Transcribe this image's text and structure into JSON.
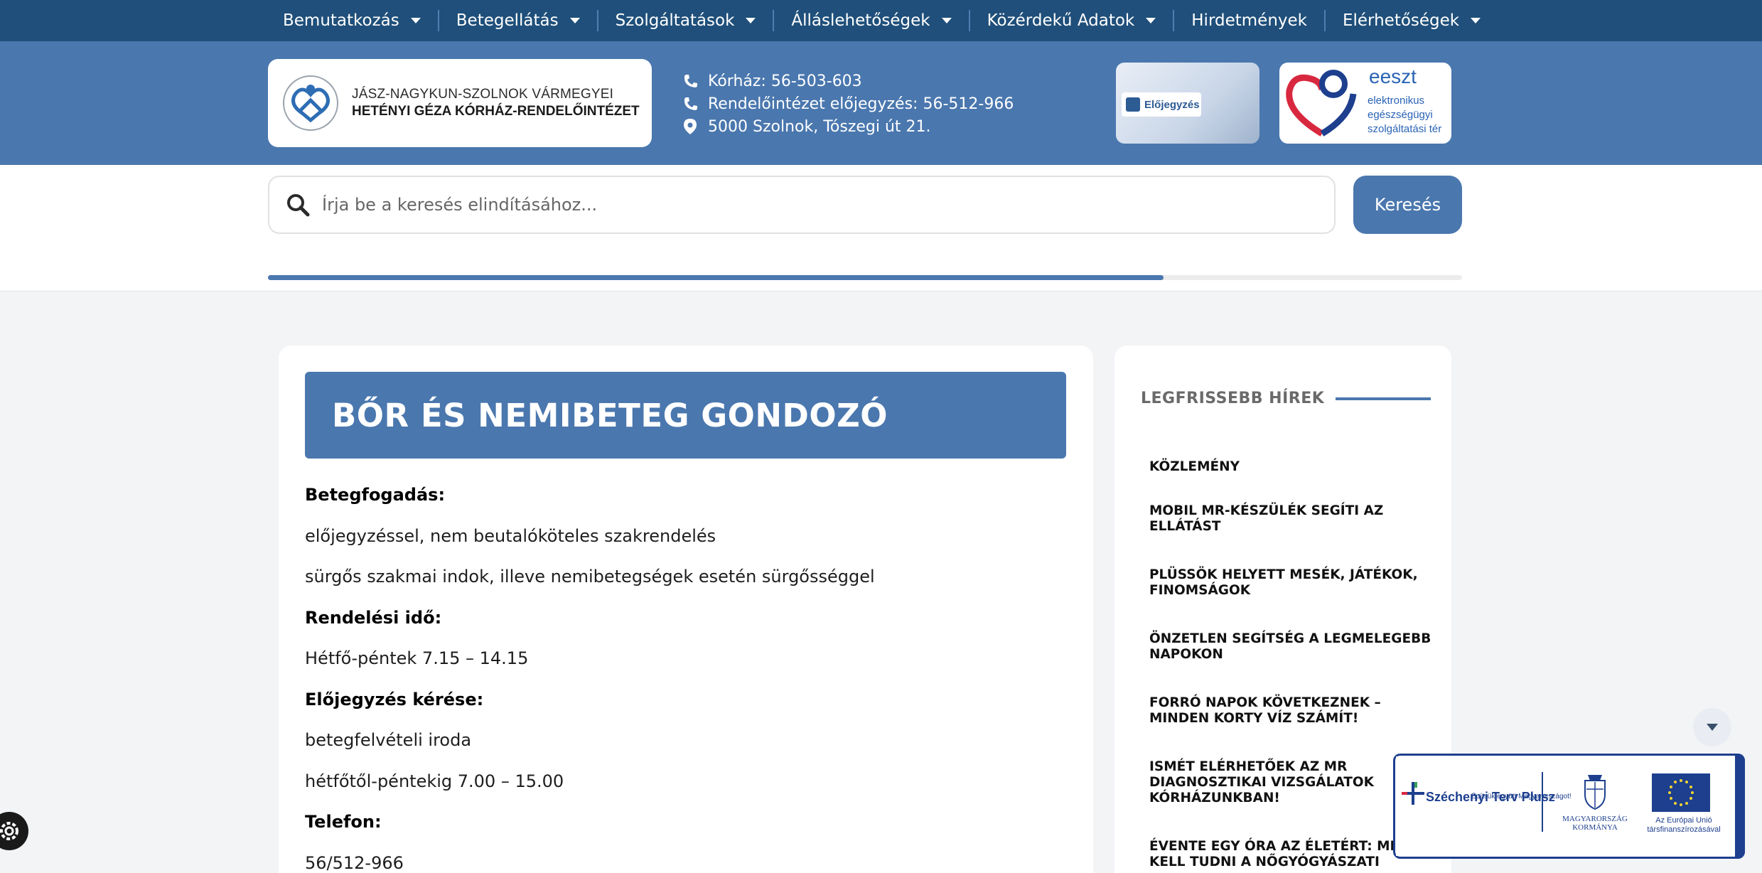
{
  "nav": {
    "items": [
      {
        "label": "Bemutatkozás",
        "has_dropdown": true
      },
      {
        "label": "Betegellátás",
        "has_dropdown": true
      },
      {
        "label": "Szolgáltatások",
        "has_dropdown": true
      },
      {
        "label": "Álláslehetőségek",
        "has_dropdown": true
      },
      {
        "label": "Közérdekű Adatok",
        "has_dropdown": true
      },
      {
        "label": "Hirdetmények",
        "has_dropdown": false
      },
      {
        "label": "Elérhetőségek",
        "has_dropdown": true
      }
    ]
  },
  "header": {
    "logo_line1": "JÁSZ-NAGYKUN-SZOLNOK VÁRMEGYEI",
    "logo_line2": "HETÉNYI GÉZA KÓRHÁZ-RENDELŐINTÉZET",
    "contacts": {
      "hospital_phone": "Kórház: 56-503-603",
      "clinic_booking": "Rendelőintézet előjegyzés: 56-512-966",
      "address": "5000 Szolnok, Tószegi út 21."
    },
    "elojegyzes_badge": "Előjegyzés",
    "eeszt_title": "eeszt",
    "eeszt_subtitle": "elektronikus egészségügyi szolgáltatási tér"
  },
  "search": {
    "placeholder": "Írja be a keresés elindításához...",
    "button_label": "Keresés",
    "progress": 0.75
  },
  "article": {
    "title": "BŐR ÉS NEMIBETEG GONDOZÓ",
    "lines": [
      {
        "text": "Betegfogadás:",
        "bold": true
      },
      {
        "text": "előjegyzéssel, nem beutalóköteles szakrendelés",
        "bold": false
      },
      {
        "text": "sürgős szakmai indok, illeve nemibetegségek esetén sürgősséggel",
        "bold": false
      },
      {
        "text": "Rendelési idő:",
        "bold": true
      },
      {
        "text": "Hétfő-péntek 7.15 – 14.15",
        "bold": false
      },
      {
        "text": "Előjegyzés kérése:",
        "bold": true
      },
      {
        "text": "betegfelvételi iroda",
        "bold": false
      },
      {
        "text": "hétfőtől-péntekig 7.00 – 15.00",
        "bold": false
      },
      {
        "text": "Telefon:",
        "bold": true
      },
      {
        "text": "56/512-966",
        "bold": false
      }
    ]
  },
  "sidebar": {
    "heading": "LEGFRISSEBB HÍREK",
    "news": [
      "KÖZLEMÉNY",
      "MOBIL MR-KÉSZÜLÉK SEGÍTI AZ ELLÁTÁST",
      "PLÜSSÖK HELYETT MESÉK, JÁTÉKOK, FINOMSÁGOK",
      "ÖNZETLEN SEGÍTSÉG A LEGMELEGEBB NAPOKON",
      "FORRÓ NAPOK KÖVETKEZNEK – MINDEN KORTY VÍZ SZÁMÍT!",
      "ISMÉT ELÉRHETŐEK AZ MR DIAGNOSZTIKAI VIZSGÁLATOK KÓRHÁZUNKBAN!",
      "ÉVENTE EGY ÓRA AZ ÉLETÉRT: MIT KELL TUDNI A NŐGYÓGYÁSZATI"
    ]
  },
  "sponsor": {
    "szechenyi_title": "Széchenyi Terv Plusz",
    "szechenyi_tagline": "Építsük együtt Magyarországot!",
    "gov": "MAGYARORSZÁG KORMÁNYA",
    "eu": "Az Európai Unió társfinanszírozásával"
  },
  "colors": {
    "nav_bg": "#1f4f7a",
    "brand_blue": "#4a77ae",
    "page_bg": "#f3f4f6"
  },
  "icons": {
    "phone": "phone-icon",
    "pin": "map-pin-icon",
    "search": "search-icon",
    "gear": "gear-icon",
    "scroll": "chevron-down-icon"
  }
}
